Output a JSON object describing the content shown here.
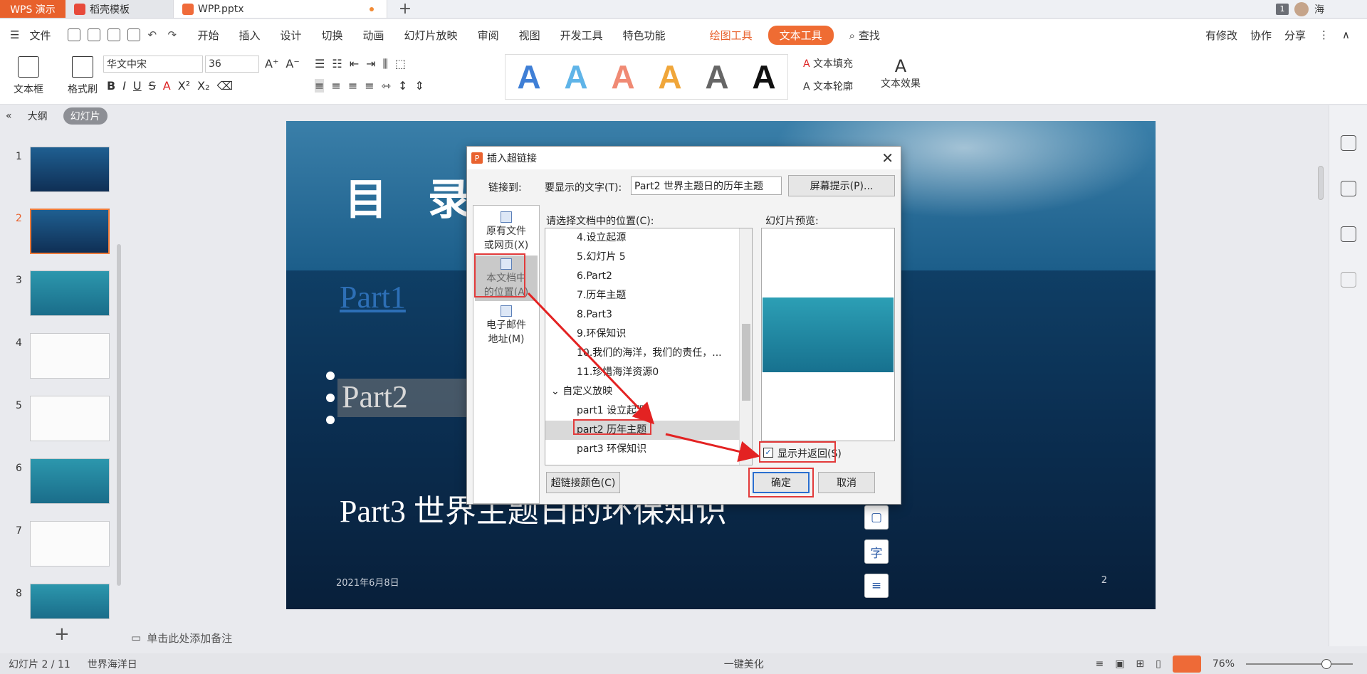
{
  "tabs": {
    "app": "WPS 演示",
    "tab1": "稻壳模板",
    "tab2": "WPP.pptx",
    "add": "+",
    "window_count": "1",
    "user": "海"
  },
  "menu": {
    "file": "文件",
    "items": [
      "开始",
      "插入",
      "设计",
      "切换",
      "动画",
      "幻灯片放映",
      "审阅",
      "视图",
      "开发工具",
      "特色功能"
    ],
    "draw_tools": "绘图工具",
    "text_tools": "文本工具",
    "search": "查找",
    "modified": "有修改",
    "collab": "协作",
    "share": "分享"
  },
  "ribbon": {
    "textbox": "文本框",
    "format_painter": "格式刷",
    "font_name": "华文中宋",
    "font_size": "36",
    "text_fill": "文本填充",
    "text_outline": "文本轮廓",
    "text_effect": "文本效果",
    "style_letters": [
      "A",
      "A",
      "A",
      "A",
      "A",
      "A"
    ],
    "style_colors": [
      "#111111",
      "#3f7fd6",
      "#5fb4e8",
      "#f08a74",
      "#f0a63a",
      "#666666"
    ]
  },
  "left_panel": {
    "outline_tab": "大纲",
    "slides_tab": "幻灯片",
    "slide_numbers": [
      "1",
      "2",
      "3",
      "4",
      "5",
      "6",
      "7",
      "8"
    ],
    "add_slide": "+"
  },
  "slide": {
    "title": "目 录",
    "part1": "Part1",
    "part2": "Part2",
    "part3": "Part3    世界主题日的环保知识",
    "date": "2021年6月8日",
    "page_number": "2",
    "float_tool_2": "字"
  },
  "dialog": {
    "title": "插入超链接",
    "link_to_label": "链接到:",
    "display_text_label": "要显示的文字(T):",
    "display_text_value": "Part2   世界主题日的历年主题",
    "screen_tip_button": "屏幕提示(P)...",
    "options": [
      {
        "line1": "原有文件",
        "line2": "或网页(X)"
      },
      {
        "line1": "本文档中",
        "line2": "的位置(A)"
      },
      {
        "line1": "电子邮件",
        "line2": "地址(M)"
      }
    ],
    "location_label": "请选择文档中的位置(C):",
    "preview_label": "幻灯片预览:",
    "list_items": [
      "4.设立起源",
      "5.幻灯片 5",
      "6.Part2",
      "7.历年主题",
      "8.Part3",
      "9.环保知识",
      "10.我们的海洋，我们的责任，...",
      "11.珍惜海洋资源0",
      "自定义放映",
      "part1 设立起源",
      "part2 历年主题",
      "part3 环保知识"
    ],
    "show_and_return": "显示并返回(S)",
    "hyperlink_color_button": "超链接颜色(C)",
    "ok_button": "确定",
    "cancel_button": "取消"
  },
  "notes": {
    "placeholder": "单击此处添加备注"
  },
  "status": {
    "slide_info": "幻灯片 2 / 11",
    "theme": "世界海洋日",
    "beautify": "一键美化",
    "zoom": "76%"
  }
}
